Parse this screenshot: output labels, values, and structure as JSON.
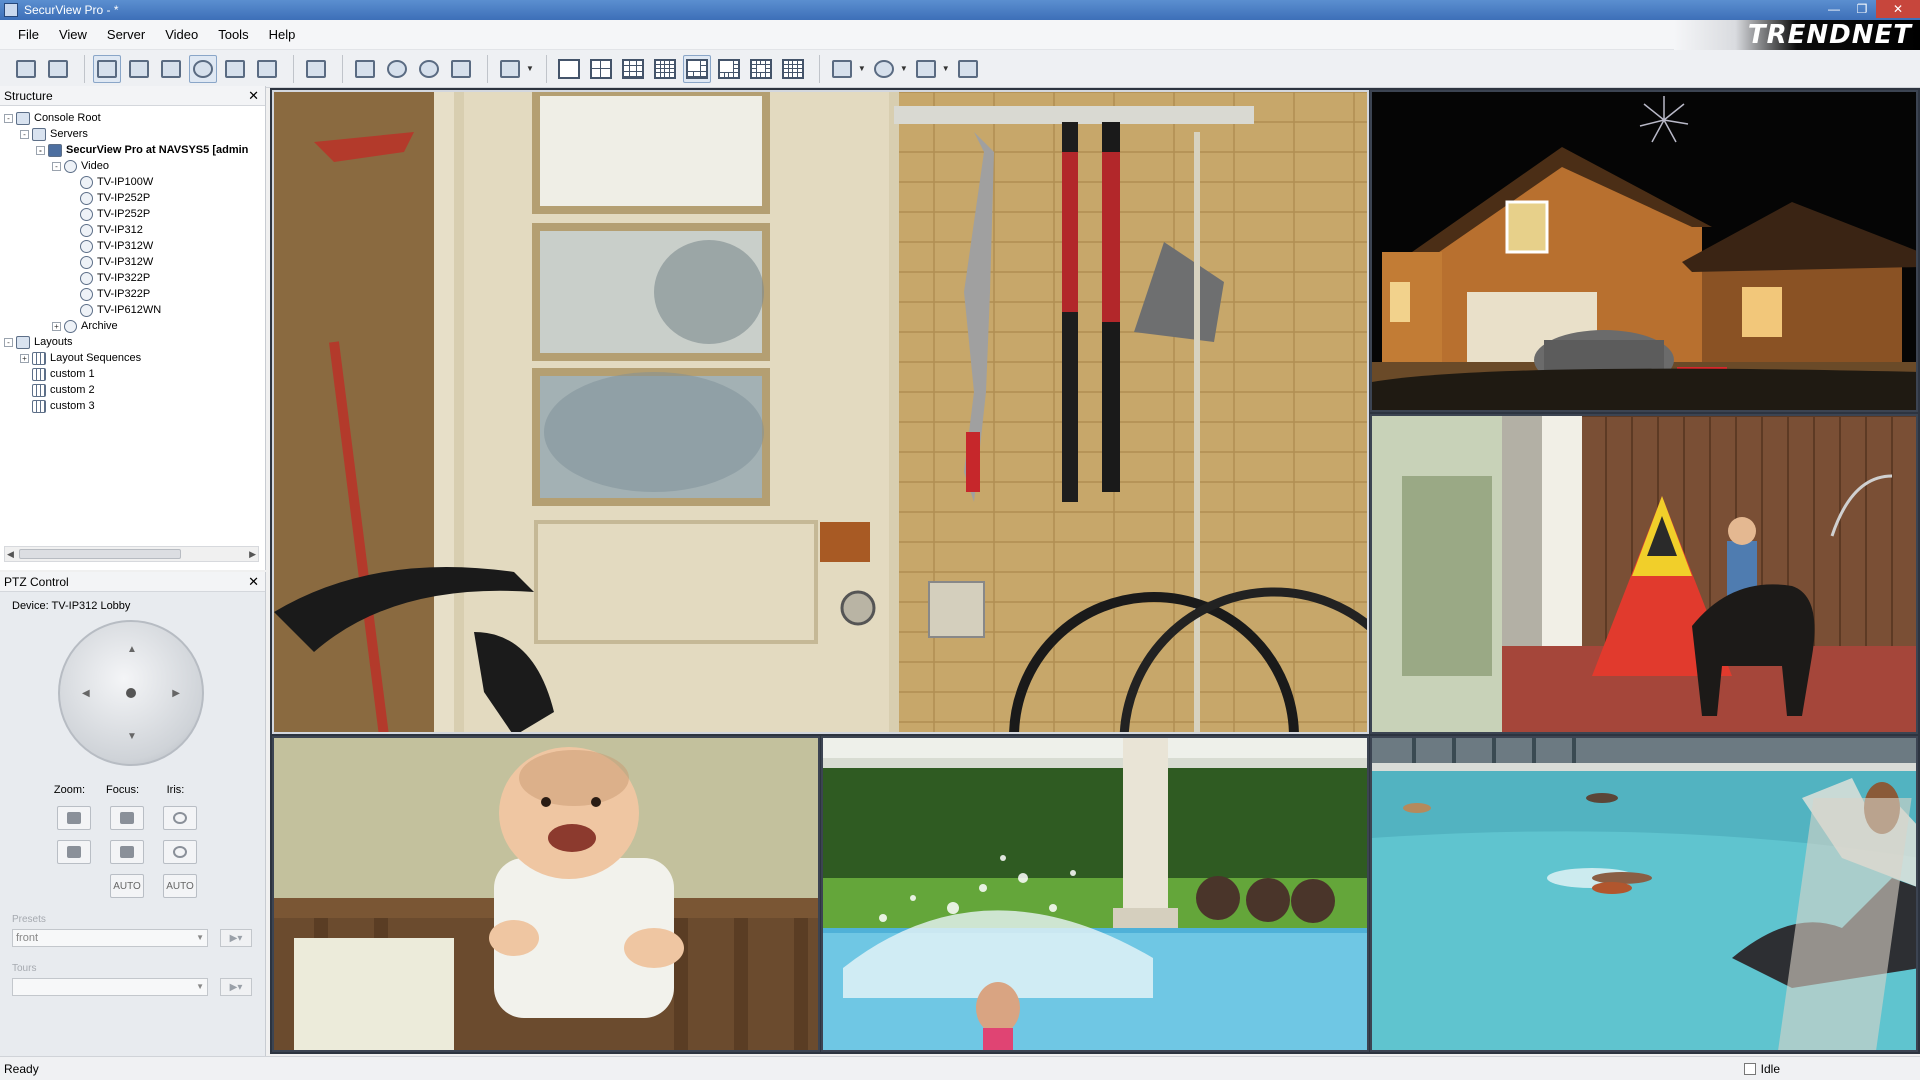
{
  "window": {
    "title": "SecurView Pro - *"
  },
  "menu": [
    "File",
    "View",
    "Server",
    "Video",
    "Tools",
    "Help"
  ],
  "brand": {
    "text": "TRENDNET"
  },
  "structure_pane": {
    "title": "Structure",
    "tree": [
      {
        "label": "Console Root",
        "depth": 0,
        "expander": "-",
        "icon": "root"
      },
      {
        "label": "Servers",
        "depth": 1,
        "expander": "-",
        "icon": "folder"
      },
      {
        "label": "SecurView Pro at NAVSYS5 [admin",
        "depth": 2,
        "expander": "-",
        "icon": "server",
        "bold": true
      },
      {
        "label": "Video",
        "depth": 3,
        "expander": "-",
        "icon": "cam"
      },
      {
        "label": "TV-IP100W",
        "depth": 4,
        "icon": "cam"
      },
      {
        "label": "TV-IP252P",
        "depth": 4,
        "icon": "cam"
      },
      {
        "label": "TV-IP252P",
        "depth": 4,
        "icon": "cam"
      },
      {
        "label": "TV-IP312",
        "depth": 4,
        "icon": "cam"
      },
      {
        "label": "TV-IP312W",
        "depth": 4,
        "icon": "cam"
      },
      {
        "label": "TV-IP312W",
        "depth": 4,
        "icon": "cam"
      },
      {
        "label": "TV-IP322P",
        "depth": 4,
        "icon": "cam"
      },
      {
        "label": "TV-IP322P",
        "depth": 4,
        "icon": "cam"
      },
      {
        "label": "TV-IP612WN",
        "depth": 4,
        "icon": "cam"
      },
      {
        "label": "Archive",
        "depth": 3,
        "expander": "+",
        "icon": "cam"
      },
      {
        "label": "Layouts",
        "depth": 0,
        "expander": "-",
        "icon": "folder"
      },
      {
        "label": "Layout Sequences",
        "depth": 1,
        "expander": "+",
        "icon": "grid"
      },
      {
        "label": "custom 1",
        "depth": 1,
        "icon": "grid"
      },
      {
        "label": "custom 2",
        "depth": 1,
        "icon": "grid"
      },
      {
        "label": "custom 3",
        "depth": 1,
        "icon": "grid"
      }
    ]
  },
  "ptz_pane": {
    "title": "PTZ Control",
    "device_label": "Device: TV-IP312 Lobby",
    "zoom_label": "Zoom:",
    "focus_label": "Focus:",
    "iris_label": "Iris:",
    "auto_label": "AUTO",
    "presets_label": "Presets",
    "presets_value": "front",
    "tours_label": "Tours",
    "tours_value": ""
  },
  "status": {
    "left": "Ready",
    "right": "Idle"
  },
  "colors": {
    "title_bar": "#3d6fb8",
    "video_bg": "#2d3440",
    "selected_border": "#d3d7de"
  },
  "video_tiles": [
    {
      "scene": "garage door with tools",
      "selected": true
    },
    {
      "scene": "house at night with fireworks"
    },
    {
      "scene": "child and dog by tent"
    },
    {
      "scene": "baby in crib"
    },
    {
      "scene": "child splashing in pool"
    },
    {
      "scene": "dogs swimming in pool"
    }
  ]
}
